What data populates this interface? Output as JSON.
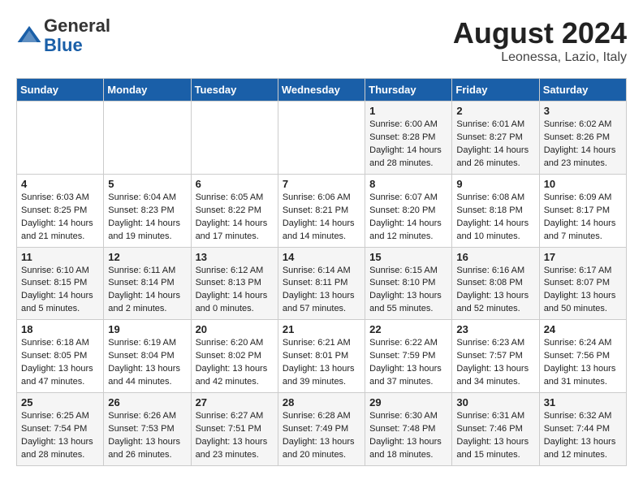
{
  "header": {
    "logo_general": "General",
    "logo_blue": "Blue",
    "month_year": "August 2024",
    "location": "Leonessa, Lazio, Italy"
  },
  "days_of_week": [
    "Sunday",
    "Monday",
    "Tuesday",
    "Wednesday",
    "Thursday",
    "Friday",
    "Saturday"
  ],
  "weeks": [
    [
      {
        "day": "",
        "sunrise": "",
        "sunset": "",
        "daylight": ""
      },
      {
        "day": "",
        "sunrise": "",
        "sunset": "",
        "daylight": ""
      },
      {
        "day": "",
        "sunrise": "",
        "sunset": "",
        "daylight": ""
      },
      {
        "day": "",
        "sunrise": "",
        "sunset": "",
        "daylight": ""
      },
      {
        "day": "1",
        "sunrise": "6:00 AM",
        "sunset": "8:28 PM",
        "daylight": "14 hours and 28 minutes."
      },
      {
        "day": "2",
        "sunrise": "6:01 AM",
        "sunset": "8:27 PM",
        "daylight": "14 hours and 26 minutes."
      },
      {
        "day": "3",
        "sunrise": "6:02 AM",
        "sunset": "8:26 PM",
        "daylight": "14 hours and 23 minutes."
      }
    ],
    [
      {
        "day": "4",
        "sunrise": "6:03 AM",
        "sunset": "8:25 PM",
        "daylight": "14 hours and 21 minutes."
      },
      {
        "day": "5",
        "sunrise": "6:04 AM",
        "sunset": "8:23 PM",
        "daylight": "14 hours and 19 minutes."
      },
      {
        "day": "6",
        "sunrise": "6:05 AM",
        "sunset": "8:22 PM",
        "daylight": "14 hours and 17 minutes."
      },
      {
        "day": "7",
        "sunrise": "6:06 AM",
        "sunset": "8:21 PM",
        "daylight": "14 hours and 14 minutes."
      },
      {
        "day": "8",
        "sunrise": "6:07 AM",
        "sunset": "8:20 PM",
        "daylight": "14 hours and 12 minutes."
      },
      {
        "day": "9",
        "sunrise": "6:08 AM",
        "sunset": "8:18 PM",
        "daylight": "14 hours and 10 minutes."
      },
      {
        "day": "10",
        "sunrise": "6:09 AM",
        "sunset": "8:17 PM",
        "daylight": "14 hours and 7 minutes."
      }
    ],
    [
      {
        "day": "11",
        "sunrise": "6:10 AM",
        "sunset": "8:15 PM",
        "daylight": "14 hours and 5 minutes."
      },
      {
        "day": "12",
        "sunrise": "6:11 AM",
        "sunset": "8:14 PM",
        "daylight": "14 hours and 2 minutes."
      },
      {
        "day": "13",
        "sunrise": "6:12 AM",
        "sunset": "8:13 PM",
        "daylight": "14 hours and 0 minutes."
      },
      {
        "day": "14",
        "sunrise": "6:14 AM",
        "sunset": "8:11 PM",
        "daylight": "13 hours and 57 minutes."
      },
      {
        "day": "15",
        "sunrise": "6:15 AM",
        "sunset": "8:10 PM",
        "daylight": "13 hours and 55 minutes."
      },
      {
        "day": "16",
        "sunrise": "6:16 AM",
        "sunset": "8:08 PM",
        "daylight": "13 hours and 52 minutes."
      },
      {
        "day": "17",
        "sunrise": "6:17 AM",
        "sunset": "8:07 PM",
        "daylight": "13 hours and 50 minutes."
      }
    ],
    [
      {
        "day": "18",
        "sunrise": "6:18 AM",
        "sunset": "8:05 PM",
        "daylight": "13 hours and 47 minutes."
      },
      {
        "day": "19",
        "sunrise": "6:19 AM",
        "sunset": "8:04 PM",
        "daylight": "13 hours and 44 minutes."
      },
      {
        "day": "20",
        "sunrise": "6:20 AM",
        "sunset": "8:02 PM",
        "daylight": "13 hours and 42 minutes."
      },
      {
        "day": "21",
        "sunrise": "6:21 AM",
        "sunset": "8:01 PM",
        "daylight": "13 hours and 39 minutes."
      },
      {
        "day": "22",
        "sunrise": "6:22 AM",
        "sunset": "7:59 PM",
        "daylight": "13 hours and 37 minutes."
      },
      {
        "day": "23",
        "sunrise": "6:23 AM",
        "sunset": "7:57 PM",
        "daylight": "13 hours and 34 minutes."
      },
      {
        "day": "24",
        "sunrise": "6:24 AM",
        "sunset": "7:56 PM",
        "daylight": "13 hours and 31 minutes."
      }
    ],
    [
      {
        "day": "25",
        "sunrise": "6:25 AM",
        "sunset": "7:54 PM",
        "daylight": "13 hours and 28 minutes."
      },
      {
        "day": "26",
        "sunrise": "6:26 AM",
        "sunset": "7:53 PM",
        "daylight": "13 hours and 26 minutes."
      },
      {
        "day": "27",
        "sunrise": "6:27 AM",
        "sunset": "7:51 PM",
        "daylight": "13 hours and 23 minutes."
      },
      {
        "day": "28",
        "sunrise": "6:28 AM",
        "sunset": "7:49 PM",
        "daylight": "13 hours and 20 minutes."
      },
      {
        "day": "29",
        "sunrise": "6:30 AM",
        "sunset": "7:48 PM",
        "daylight": "13 hours and 18 minutes."
      },
      {
        "day": "30",
        "sunrise": "6:31 AM",
        "sunset": "7:46 PM",
        "daylight": "13 hours and 15 minutes."
      },
      {
        "day": "31",
        "sunrise": "6:32 AM",
        "sunset": "7:44 PM",
        "daylight": "13 hours and 12 minutes."
      }
    ]
  ],
  "labels": {
    "sunrise_prefix": "Sunrise: ",
    "sunset_prefix": "Sunset: ",
    "daylight_prefix": "Daylight: "
  }
}
